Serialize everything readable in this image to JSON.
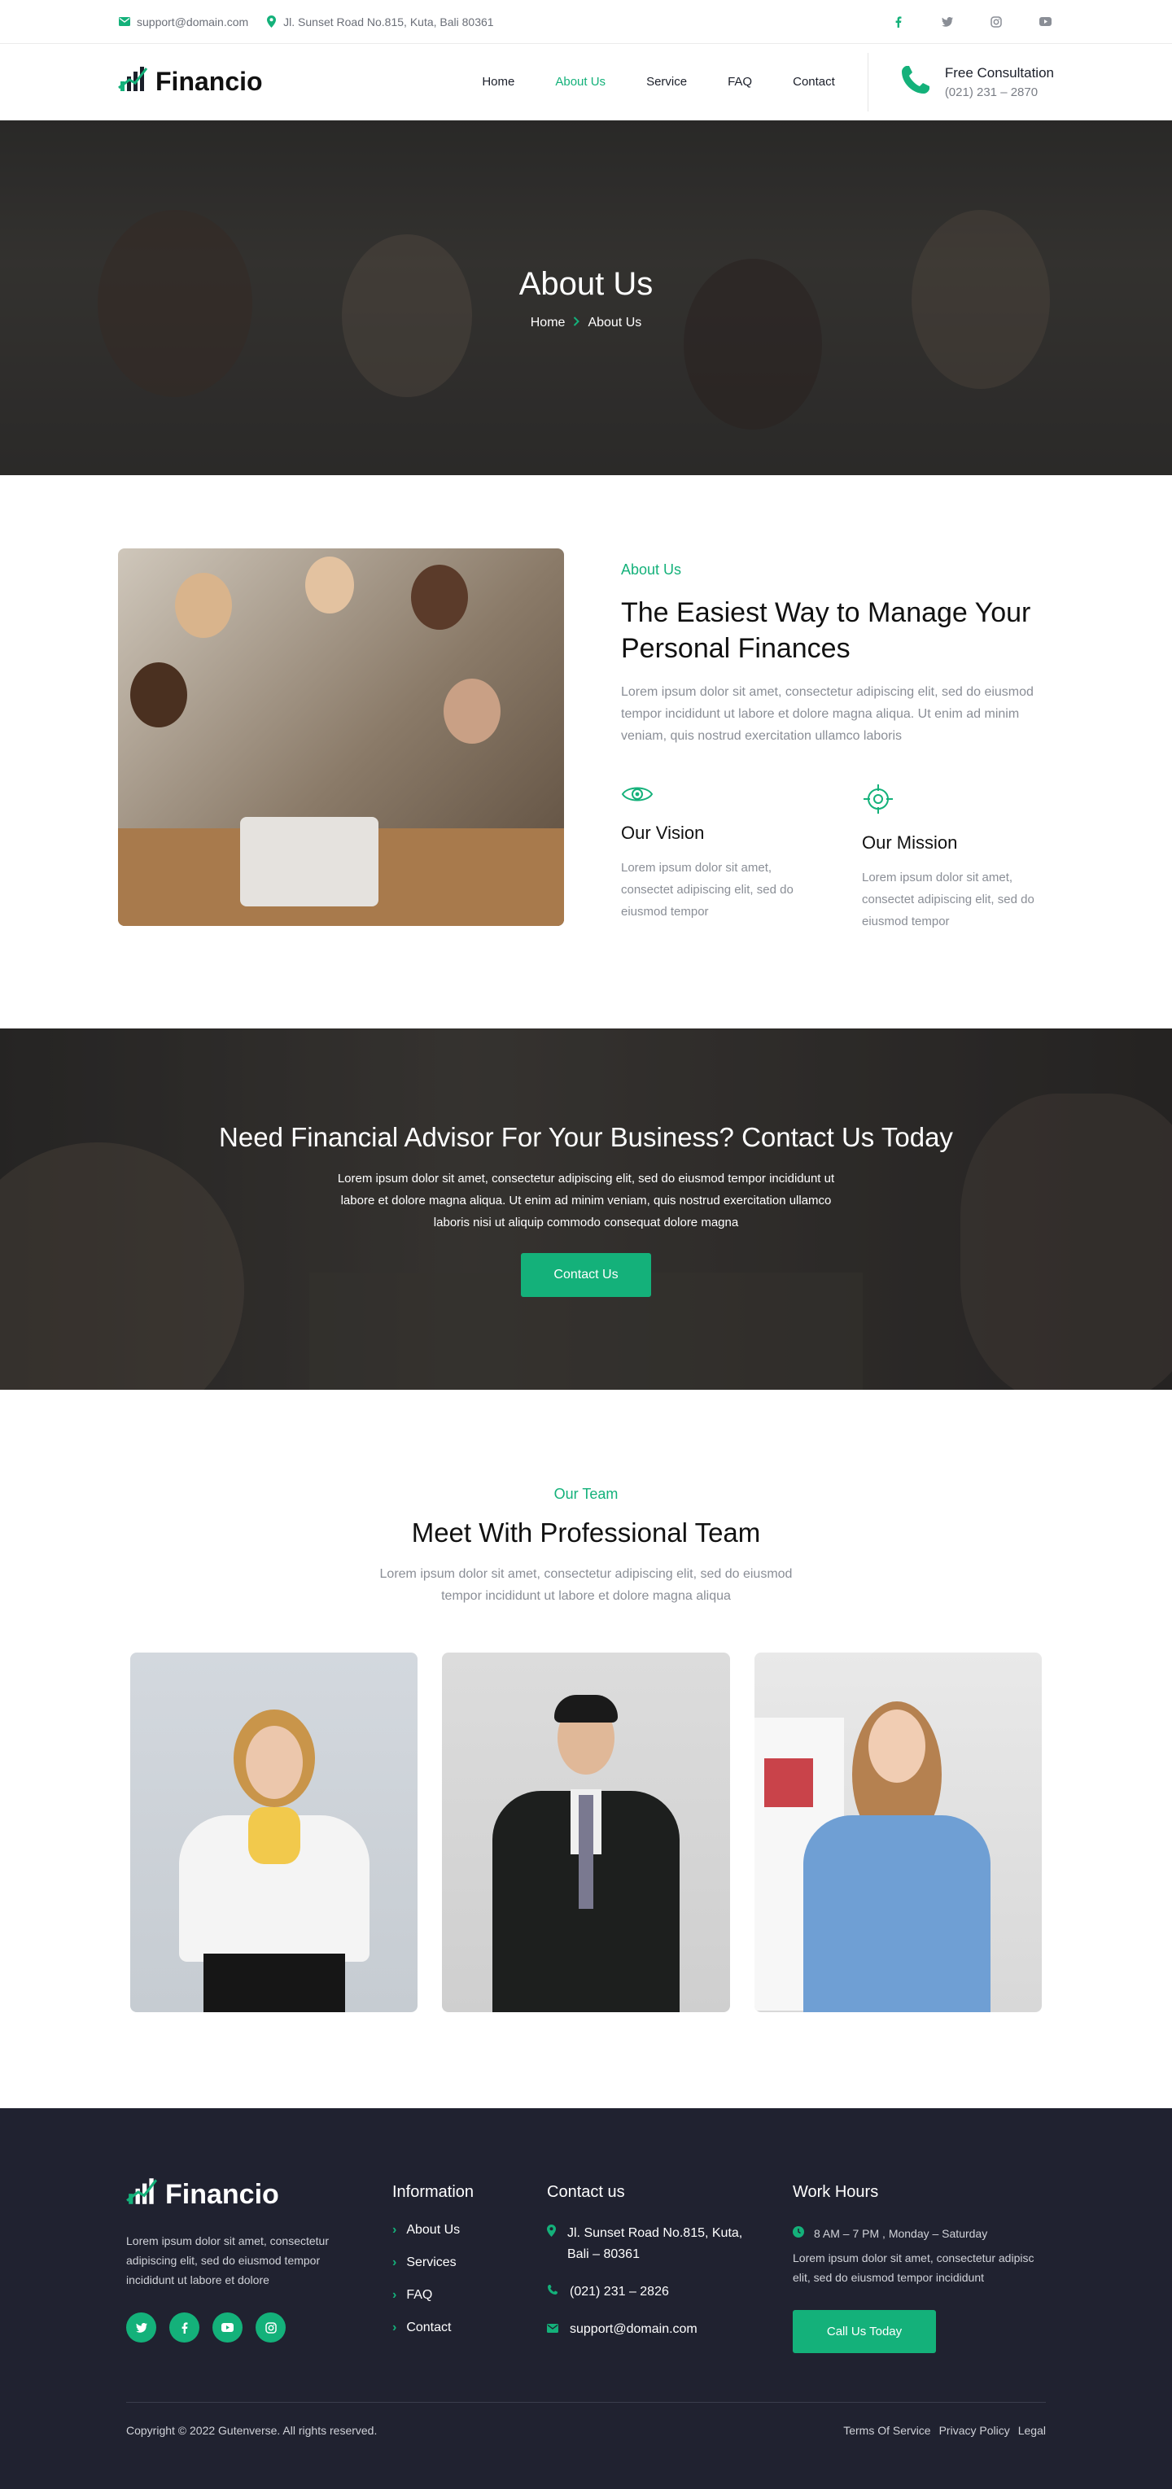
{
  "topbar": {
    "email": "support@domain.com",
    "address": "Jl. Sunset Road No.815, Kuta, Bali 80361",
    "socials": [
      "facebook-icon",
      "twitter-icon",
      "instagram-icon",
      "youtube-icon"
    ]
  },
  "nav": {
    "logo": "Financio",
    "items": [
      {
        "label": "Home"
      },
      {
        "label": "About Us"
      },
      {
        "label": "Service"
      },
      {
        "label": "FAQ"
      },
      {
        "label": "Contact"
      }
    ],
    "active_index": 1,
    "consult_title": "Free Consultation",
    "consult_phone": "(021) 231 – 2870"
  },
  "hero": {
    "title": "About Us",
    "crumb_home": "Home",
    "crumb_current": "About Us"
  },
  "about": {
    "eyebrow": "About Us",
    "heading": "The Easiest Way to Manage Your Personal Finances",
    "text": "Lorem ipsum dolor sit amet, consectetur adipiscing elit, sed do eiusmod tempor incididunt ut labore et dolore magna aliqua. Ut enim ad minim veniam, quis nostrud exercitation ullamco laboris",
    "vision_title": "Our Vision",
    "vision_text": "Lorem ipsum dolor sit amet, consectet adipiscing elit, sed do eiusmod tempor",
    "mission_title": "Our Mission",
    "mission_text": "Lorem ipsum dolor sit amet, consectet adipiscing elit, sed do eiusmod tempor"
  },
  "cta": {
    "heading": "Need Financial Advisor For Your Business? Contact Us Today",
    "text": "Lorem ipsum dolor sit amet, consectetur adipiscing elit, sed do eiusmod tempor incididunt ut labore et dolore magna aliqua. Ut enim ad minim veniam, quis nostrud exercitation ullamco laboris nisi ut aliquip commodo consequat dolore magna",
    "button": "Contact Us"
  },
  "team": {
    "eyebrow": "Our Team",
    "heading": "Meet With Professional Team",
    "text": "Lorem ipsum dolor sit amet, consectetur adipiscing elit, sed do eiusmod tempor incididunt ut labore et dolore magna aliqua"
  },
  "footer": {
    "logo": "Financio",
    "about_text": "Lorem ipsum dolor sit amet, consectetur adipiscing elit, sed do eiusmod tempor incididunt ut labore et dolore",
    "info_title": "Information",
    "info_links": [
      "About Us",
      "Services",
      "FAQ",
      "Contact"
    ],
    "contact_title": "Contact us",
    "contact_address": "Jl. Sunset Road No.815, Kuta, Bali – 80361",
    "contact_phone": "(021) 231 – 2826",
    "contact_email": "support@domain.com",
    "hours_title": "Work Hours",
    "hours": "8 AM – 7 PM , Monday – Saturday",
    "hours_text": "Lorem ipsum dolor sit amet, consectetur adipisc elit, sed do eiusmod tempor incididunt",
    "call_button": "Call Us Today",
    "copyright": "Copyright © 2022 Gutenverse. All rights reserved.",
    "legal": [
      "Terms Of Service",
      "Privacy Policy",
      "Legal"
    ]
  },
  "colors": {
    "accent": "#14b17a",
    "footer_bg": "#202230",
    "text_dark": "#111111",
    "text_muted": "#8a8e96"
  }
}
